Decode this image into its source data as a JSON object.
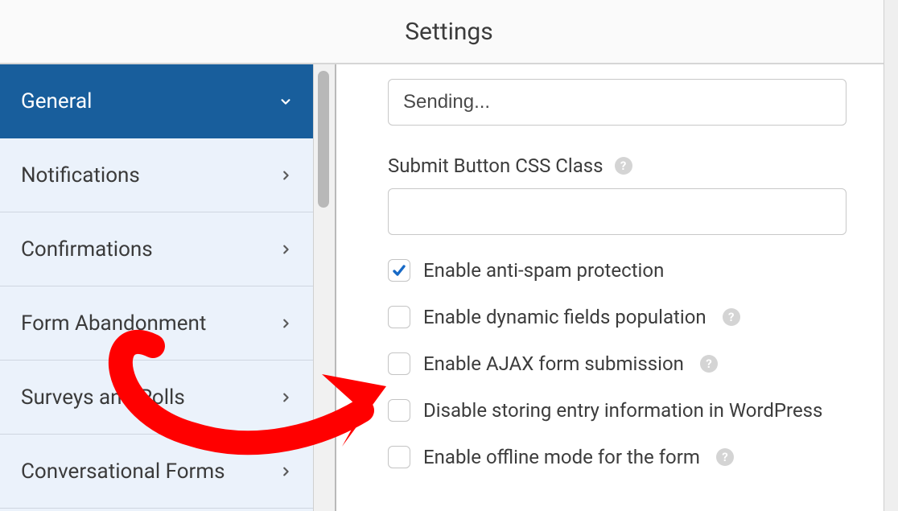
{
  "header": {
    "title": "Settings"
  },
  "sidebar": {
    "items": [
      {
        "label": "General",
        "active": true,
        "expanded": true
      },
      {
        "label": "Notifications",
        "active": false,
        "expanded": false
      },
      {
        "label": "Confirmations",
        "active": false,
        "expanded": false
      },
      {
        "label": "Form Abandonment",
        "active": false,
        "expanded": false
      },
      {
        "label": "Surveys and Polls",
        "active": false,
        "expanded": false
      },
      {
        "label": "Conversational Forms",
        "active": false,
        "expanded": false
      }
    ]
  },
  "main": {
    "sending_value": "Sending...",
    "css_class_label": "Submit Button CSS Class",
    "css_class_value": "",
    "checks": [
      {
        "label": "Enable anti-spam protection",
        "checked": true,
        "help": false
      },
      {
        "label": "Enable dynamic fields population",
        "checked": false,
        "help": true
      },
      {
        "label": "Enable AJAX form submission",
        "checked": false,
        "help": true
      },
      {
        "label": "Disable storing entry information in WordPress",
        "checked": false,
        "help": false
      },
      {
        "label": "Enable offline mode for the form",
        "checked": false,
        "help": true
      }
    ]
  }
}
